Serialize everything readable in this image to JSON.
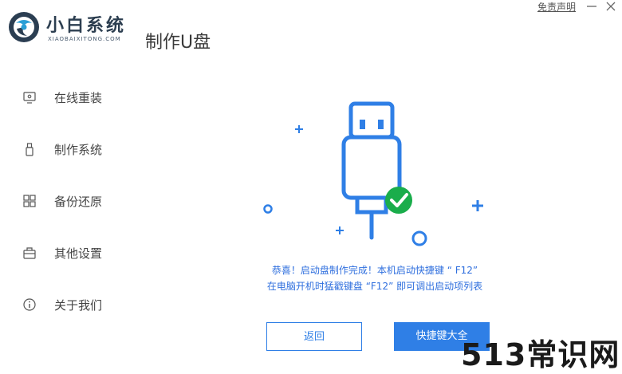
{
  "brand": {
    "name": "小白系统",
    "url": "XIAOBAIXITONG.COM"
  },
  "page": {
    "title": "制作U盘"
  },
  "window": {
    "disclaimer": "免责声明",
    "minimize_icon": "minimize-icon",
    "close_icon": "close-icon"
  },
  "sidebar": {
    "items": [
      {
        "label": "在线重装",
        "icon": "monitor-icon"
      },
      {
        "label": "制作系统",
        "icon": "usb-drive-icon"
      },
      {
        "label": "备份还原",
        "icon": "grid-icon"
      },
      {
        "label": "其他设置",
        "icon": "toolbox-icon"
      },
      {
        "label": "关于我们",
        "icon": "info-icon"
      }
    ]
  },
  "main": {
    "illustration": {
      "icon": "usb-plug-icon",
      "status_icon": "check-badge-icon"
    },
    "message_line1": "恭喜！启动盘制作完成！本机启动快捷键 “ F12”",
    "message_line2": "在电脑开机时猛戳键盘 “F12” 即可调出启动项列表",
    "back_button": "返回",
    "hotkeys_button": "快捷键大全"
  },
  "watermark": "513常识网",
  "colors": {
    "accent": "#2f7fe6",
    "success": "#1aad4b",
    "message": "#2f6fde"
  }
}
